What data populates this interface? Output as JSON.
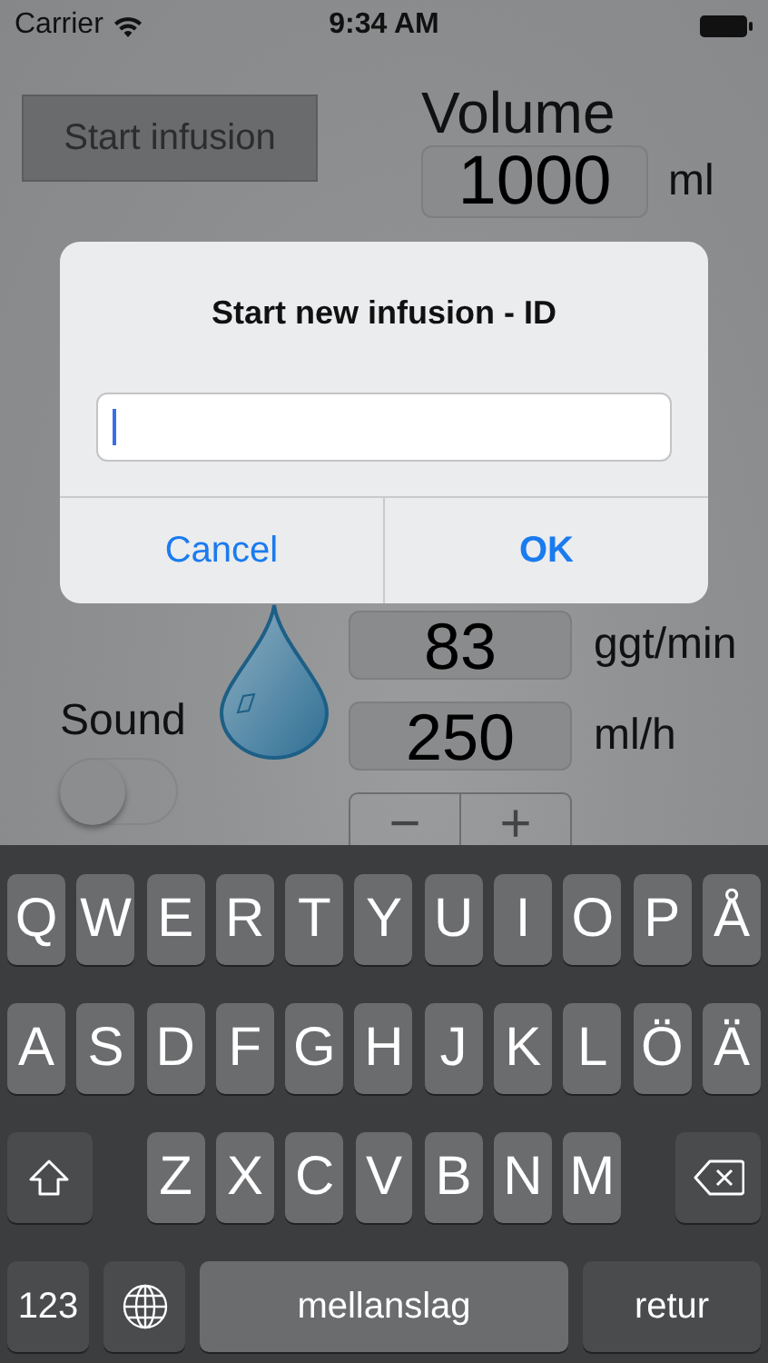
{
  "status_bar": {
    "carrier": "Carrier",
    "time": "9:34 AM"
  },
  "screen": {
    "start_button": "Start infusion",
    "volume_label": "Volume",
    "volume_value": "1000",
    "volume_unit": "ml",
    "sound_label": "Sound",
    "sound_on": false,
    "rate_fields": [
      {
        "value": "83",
        "unit": "ggt/min"
      },
      {
        "value": "250",
        "unit": "ml/h"
      }
    ],
    "stepper": [
      "−",
      "+"
    ]
  },
  "dialog": {
    "title": "Start new infusion - ID",
    "input": {
      "focused": true
    },
    "buttons": [
      {
        "label": "Cancel",
        "kind": "cancel"
      },
      {
        "label": "OK",
        "kind": "confirm"
      }
    ]
  },
  "keyboard": {
    "rows": [
      {
        "keys": [
          {
            "kind": "letter",
            "label": "Q"
          },
          {
            "kind": "letter",
            "label": "W"
          },
          {
            "kind": "letter",
            "label": "E"
          },
          {
            "kind": "letter",
            "label": "R"
          },
          {
            "kind": "letter",
            "label": "T"
          },
          {
            "kind": "letter",
            "label": "Y"
          },
          {
            "kind": "letter",
            "label": "U"
          },
          {
            "kind": "letter",
            "label": "I"
          },
          {
            "kind": "letter",
            "label": "O"
          },
          {
            "kind": "letter",
            "label": "P"
          },
          {
            "kind": "letter",
            "label": "Å"
          }
        ]
      },
      {
        "keys": [
          {
            "kind": "letter",
            "label": "A"
          },
          {
            "kind": "letter",
            "label": "S"
          },
          {
            "kind": "letter",
            "label": "D"
          },
          {
            "kind": "letter",
            "label": "F"
          },
          {
            "kind": "letter",
            "label": "G"
          },
          {
            "kind": "letter",
            "label": "H"
          },
          {
            "kind": "letter",
            "label": "J"
          },
          {
            "kind": "letter",
            "label": "K"
          },
          {
            "kind": "letter",
            "label": "L"
          },
          {
            "kind": "letter",
            "label": "Ö"
          },
          {
            "kind": "letter",
            "label": "Ä"
          }
        ]
      },
      {
        "keys": [
          {
            "kind": "shift"
          },
          {
            "kind": "letter",
            "label": "Z"
          },
          {
            "kind": "letter",
            "label": "X"
          },
          {
            "kind": "letter",
            "label": "C"
          },
          {
            "kind": "letter",
            "label": "V"
          },
          {
            "kind": "letter",
            "label": "B"
          },
          {
            "kind": "letter",
            "label": "N"
          },
          {
            "kind": "letter",
            "label": "M"
          },
          {
            "kind": "delete"
          }
        ]
      },
      {
        "keys": [
          {
            "kind": "mode",
            "label": "123"
          },
          {
            "kind": "globe"
          },
          {
            "kind": "space",
            "label": "mellanslag"
          },
          {
            "kind": "return",
            "label": "retur"
          }
        ]
      }
    ]
  }
}
